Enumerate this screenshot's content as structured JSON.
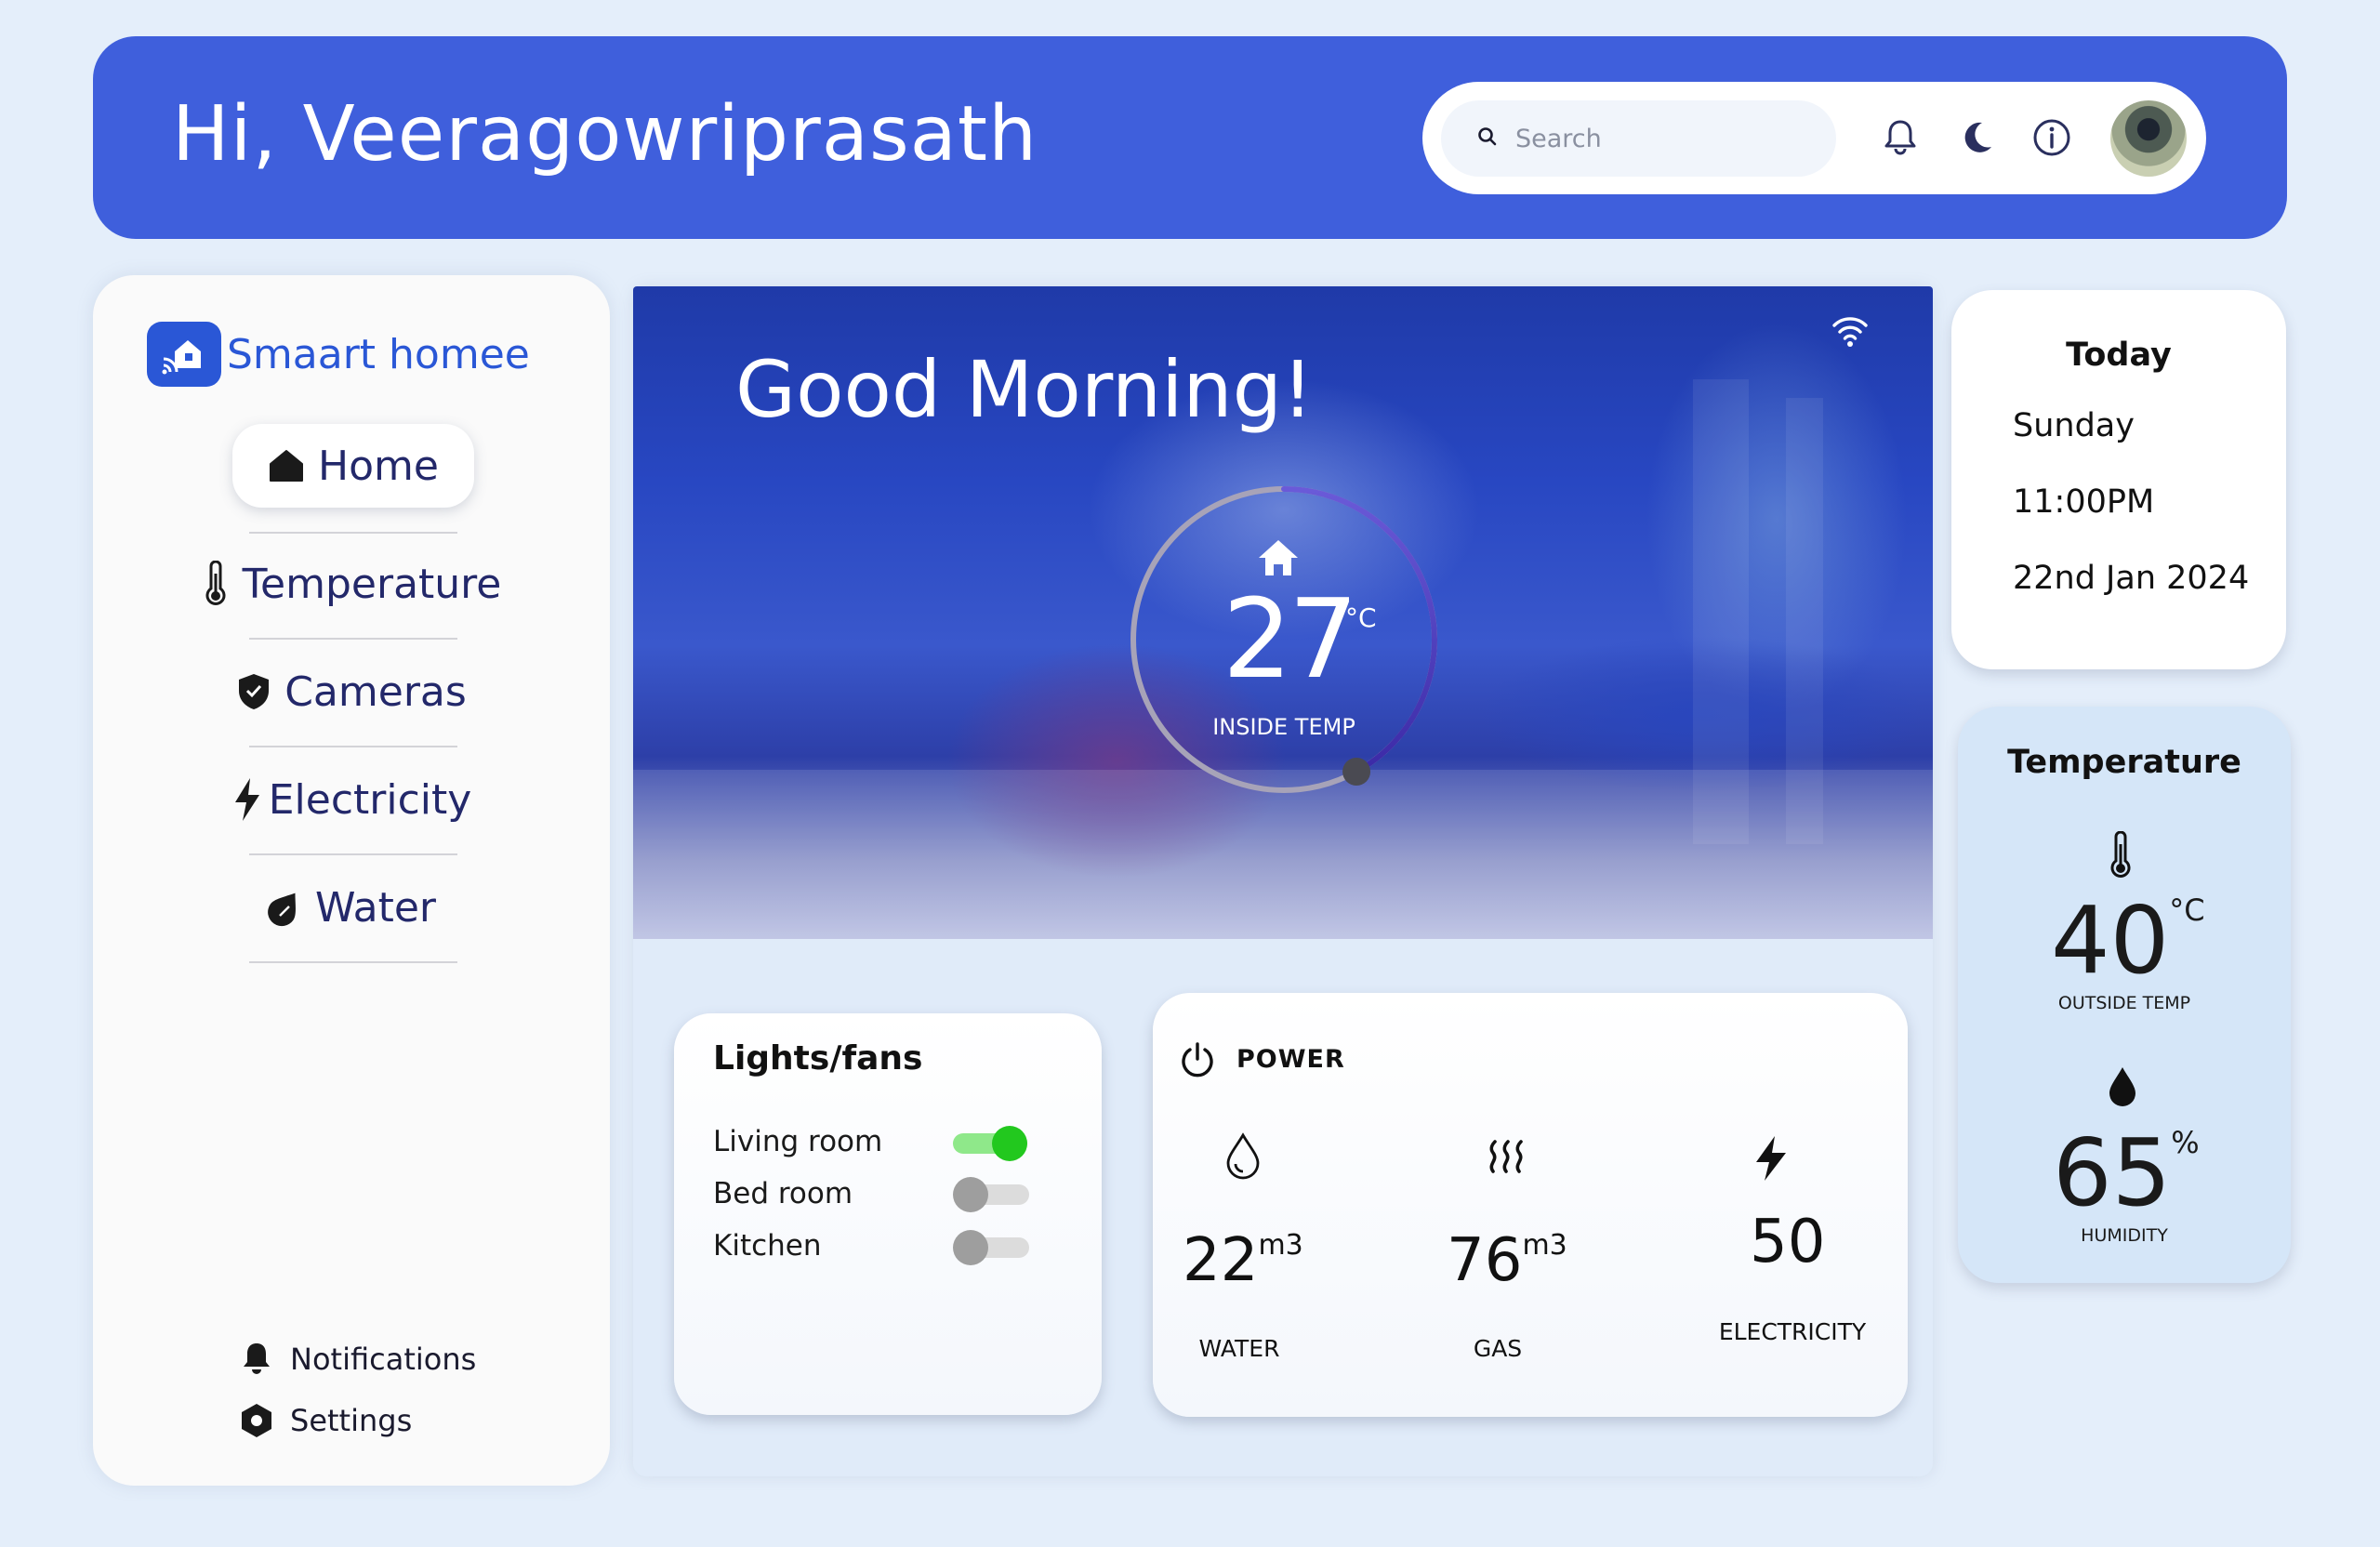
{
  "header": {
    "greeting": "Hi, Veeragowriprasath",
    "search_placeholder": "Search"
  },
  "sidebar": {
    "brand": "Smaart homee",
    "nav": [
      {
        "label": "Home",
        "icon": "home-icon",
        "active": true
      },
      {
        "label": "Temperature",
        "icon": "thermometer-icon"
      },
      {
        "label": "Cameras",
        "icon": "shield-icon"
      },
      {
        "label": "Electricity",
        "icon": "bolt-icon"
      },
      {
        "label": "Water",
        "icon": "water-drop-icon"
      }
    ],
    "footer": [
      {
        "label": "Notifications",
        "icon": "bell-icon"
      },
      {
        "label": "Settings",
        "icon": "settings-icon"
      }
    ]
  },
  "hero": {
    "title": "Good Morning!",
    "inside_temp": "27",
    "inside_temp_unit": "°C",
    "inside_temp_label": "INSIDE TEMP",
    "dial_progress": 0.42
  },
  "lights": {
    "title": "Lights/fans",
    "rooms": [
      {
        "label": "Living room",
        "on": true
      },
      {
        "label": "Bed room",
        "on": false
      },
      {
        "label": "Kitchen",
        "on": false
      }
    ]
  },
  "power": {
    "title": "POWER",
    "items": [
      {
        "value": "22",
        "unit": "m3",
        "label": "WATER",
        "icon": "water-drop-icon"
      },
      {
        "value": "76",
        "unit": "m3",
        "label": "GAS",
        "icon": "heat-waves-icon"
      },
      {
        "value": "50",
        "unit": "",
        "label": "ELECTRICITY",
        "icon": "bolt-icon"
      }
    ]
  },
  "today": {
    "title": "Today",
    "day": "Sunday",
    "time": "11:00PM",
    "date": "22nd Jan 2024"
  },
  "temperature_card": {
    "title": "Temperature",
    "outside_temp": "40",
    "outside_unit": "°C",
    "outside_label": "OUTSIDE TEMP",
    "humidity": "65",
    "humidity_unit": "%",
    "humidity_label": "HUMIDITY"
  },
  "colors": {
    "accent": "#3f5fdc",
    "brand": "#2a57d6",
    "toggle_on": "#22c81e",
    "background": "#e4eefa"
  }
}
